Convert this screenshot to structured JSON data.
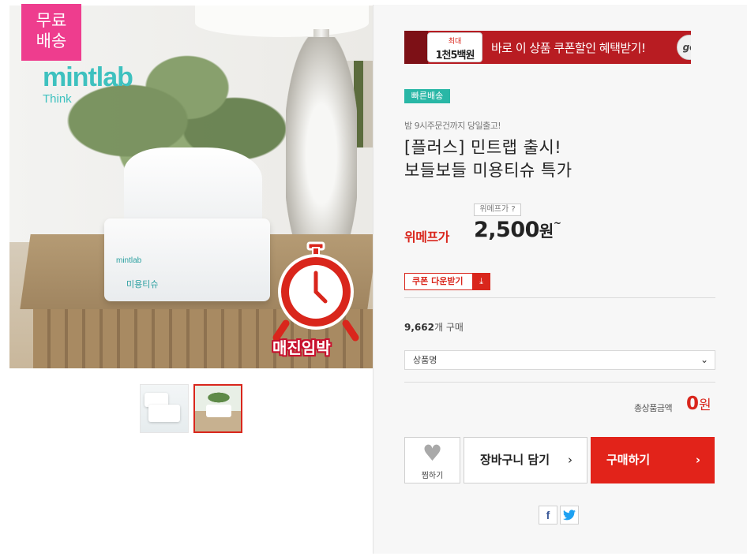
{
  "left": {
    "badge_free": "무료\n배송",
    "photo_brand": "mintlab",
    "photo_brand_sub": "Think",
    "box_brand": "mintlab",
    "box_name": "미용티슈",
    "deadline": "매진임박"
  },
  "coupon": {
    "max_label": "최대",
    "max_value": "1천5백원",
    "message": "바로 이 상품 쿠폰할인 혜택받기!",
    "go_label": "go"
  },
  "product": {
    "fast_badge": "빠른배송",
    "ship_note": "밤 9시주문건까지 당일출고!",
    "title_line1": "[플러스] 민트랩 출시!",
    "title_line2": "보들보들 미용티슈 특가",
    "price_tag_label": "위메프가 ?",
    "price_label": "위메프가",
    "price": "2,500",
    "price_unit": "원",
    "price_tilde": "~",
    "coupon_button": "쿠폰 다운받기",
    "buy_count": "9,662",
    "buy_count_suffix": "개 구매",
    "select_placeholder": "상품명",
    "total_label": "총상품금액",
    "total_value": "0",
    "total_unit": "원"
  },
  "actions": {
    "wish_label": "찜하기",
    "cart_label": "장바구니 담기",
    "buy_label": "구매하기"
  },
  "share": {
    "facebook": "f",
    "twitter": "🐦"
  },
  "colors": {
    "accent_red": "#e2231a",
    "fast_green": "#29b7a6",
    "badge_pink": "#ee3d8e"
  }
}
